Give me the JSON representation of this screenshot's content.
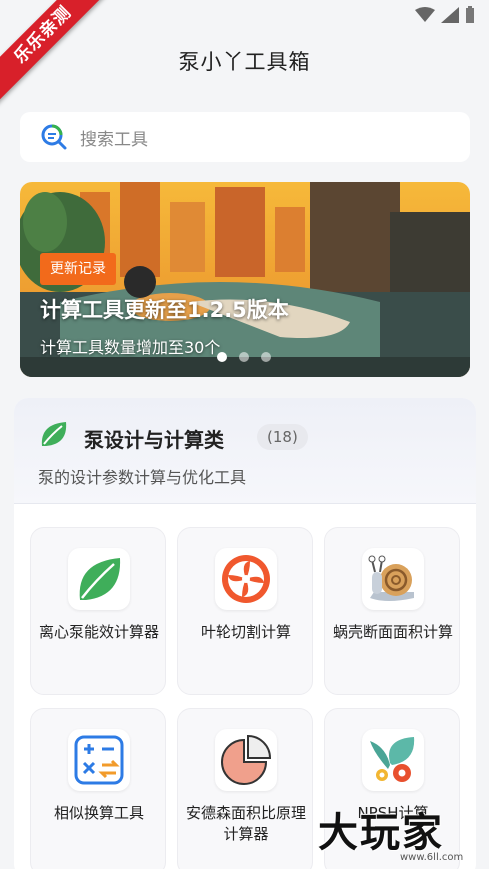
{
  "app": {
    "title": "泵小丫工具箱",
    "ribbon": "乐乐亲测"
  },
  "search": {
    "placeholder": "搜索工具"
  },
  "banner": {
    "badge": "更新记录",
    "title": "计算工具更新至1.2.5版本",
    "subtitle": "计算工具数量增加至30个",
    "active_slide": 1,
    "slide_count": 3
  },
  "category": {
    "title": "泵设计与计算类",
    "count": "(18)",
    "description": "泵的设计参数计算与优化工具",
    "tools": [
      {
        "label": "离心泵能效计算器",
        "icon": "leaf-icon"
      },
      {
        "label": "叶轮切割计算",
        "icon": "impeller-icon"
      },
      {
        "label": "蜗壳断面面积计算",
        "icon": "snail-icon"
      },
      {
        "label": "相似换算工具",
        "icon": "calculator-icon"
      },
      {
        "label": "安德森面积比原理计算器",
        "icon": "pie-chart-icon"
      },
      {
        "label": "NPSH计算",
        "icon": "gears-leaf-icon"
      }
    ]
  },
  "watermark": {
    "text": "大玩家",
    "url": "www.6ll.com"
  },
  "colors": {
    "accent": "#f26a1b",
    "leaf": "#3fae5a",
    "background": "#f4f5f7"
  }
}
